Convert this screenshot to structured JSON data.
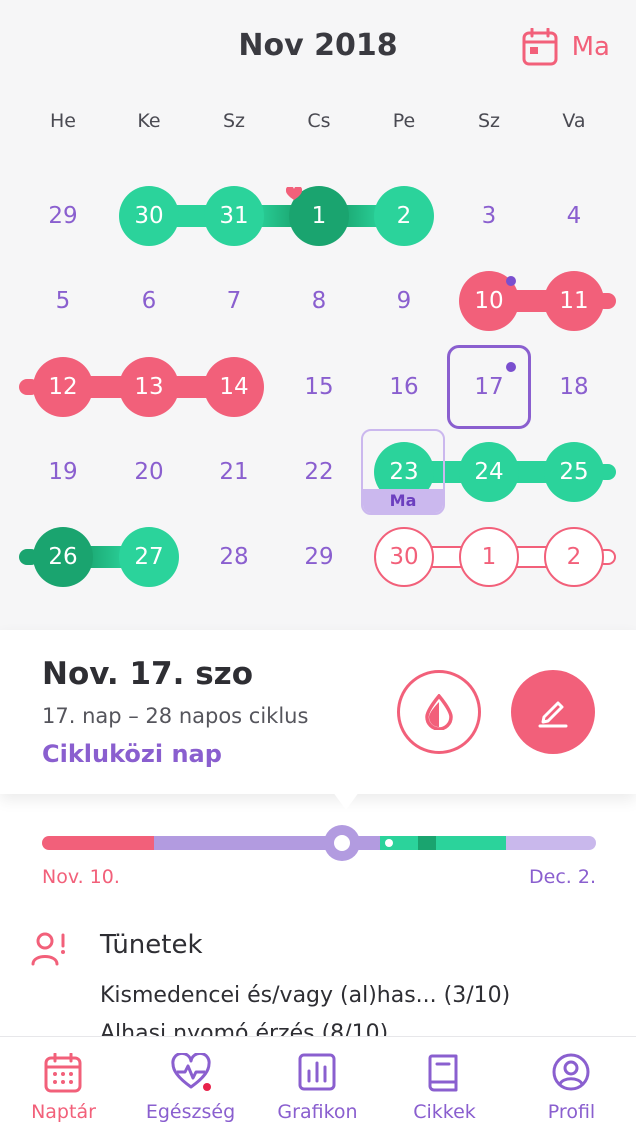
{
  "header": {
    "month": "Nov 2018",
    "today_label": "Ma"
  },
  "weekdays": [
    "He",
    "Ke",
    "Sz",
    "Cs",
    "Pe",
    "Sz",
    "Va"
  ],
  "weeks": [
    [
      {
        "d": "29",
        "s": "plain"
      },
      {
        "d": "30",
        "s": "fertile"
      },
      {
        "d": "31",
        "s": "fertile"
      },
      {
        "d": "1",
        "s": "ovulation",
        "heart": true
      },
      {
        "d": "2",
        "s": "fertile"
      },
      {
        "d": "3",
        "s": "plain"
      },
      {
        "d": "4",
        "s": "plain"
      }
    ],
    [
      {
        "d": "5",
        "s": "plain"
      },
      {
        "d": "6",
        "s": "plain"
      },
      {
        "d": "7",
        "s": "plain"
      },
      {
        "d": "8",
        "s": "plain"
      },
      {
        "d": "9",
        "s": "plain"
      },
      {
        "d": "10",
        "s": "period",
        "dot": true
      },
      {
        "d": "11",
        "s": "period"
      }
    ],
    [
      {
        "d": "12",
        "s": "period"
      },
      {
        "d": "13",
        "s": "period"
      },
      {
        "d": "14",
        "s": "period"
      },
      {
        "d": "15",
        "s": "plain"
      },
      {
        "d": "16",
        "s": "plain"
      },
      {
        "d": "17",
        "s": "plain",
        "selected": true,
        "dot": true
      },
      {
        "d": "18",
        "s": "plain"
      }
    ],
    [
      {
        "d": "19",
        "s": "plain"
      },
      {
        "d": "20",
        "s": "plain"
      },
      {
        "d": "21",
        "s": "plain"
      },
      {
        "d": "22",
        "s": "plain"
      },
      {
        "d": "23",
        "s": "fertile",
        "today": true
      },
      {
        "d": "24",
        "s": "fertile"
      },
      {
        "d": "25",
        "s": "fertile"
      }
    ],
    [
      {
        "d": "26",
        "s": "ovulation"
      },
      {
        "d": "27",
        "s": "fertile"
      },
      {
        "d": "28",
        "s": "plain"
      },
      {
        "d": "29",
        "s": "plain"
      },
      {
        "d": "30",
        "s": "predicted"
      },
      {
        "d": "1",
        "s": "predicted"
      },
      {
        "d": "2",
        "s": "predicted"
      }
    ]
  ],
  "colors": {
    "period": "#f2607a",
    "fertile": "#2bd39b",
    "ovulation": "#1aa46f",
    "regular": "#b29be0",
    "accent": "#8a5fcf"
  },
  "detail": {
    "date": "Nov. 17. szo",
    "subtitle": "17. nap – 28 napos ciklus",
    "phase": "Cikluközi nap",
    "drop_icon": "drop-icon",
    "edit_icon": "pencil-icon"
  },
  "cycle_bar": {
    "start_label": "Nov. 10.",
    "end_label": "Dec. 2.",
    "current_day": 17,
    "length": 23
  },
  "symptoms": {
    "title": "Tünetek",
    "items": [
      "Kismedencei és/vagy (al)has... (3/10)",
      "Alhasi nyomó érzés (8/10)"
    ]
  },
  "tabs": [
    {
      "label": "Naptár",
      "icon": "calendar-icon",
      "active": true
    },
    {
      "label": "Egészség",
      "icon": "heart-pulse-icon",
      "badge": true
    },
    {
      "label": "Grafikon",
      "icon": "chart-icon"
    },
    {
      "label": "Cikkek",
      "icon": "book-icon"
    },
    {
      "label": "Profil",
      "icon": "profile-icon"
    }
  ]
}
